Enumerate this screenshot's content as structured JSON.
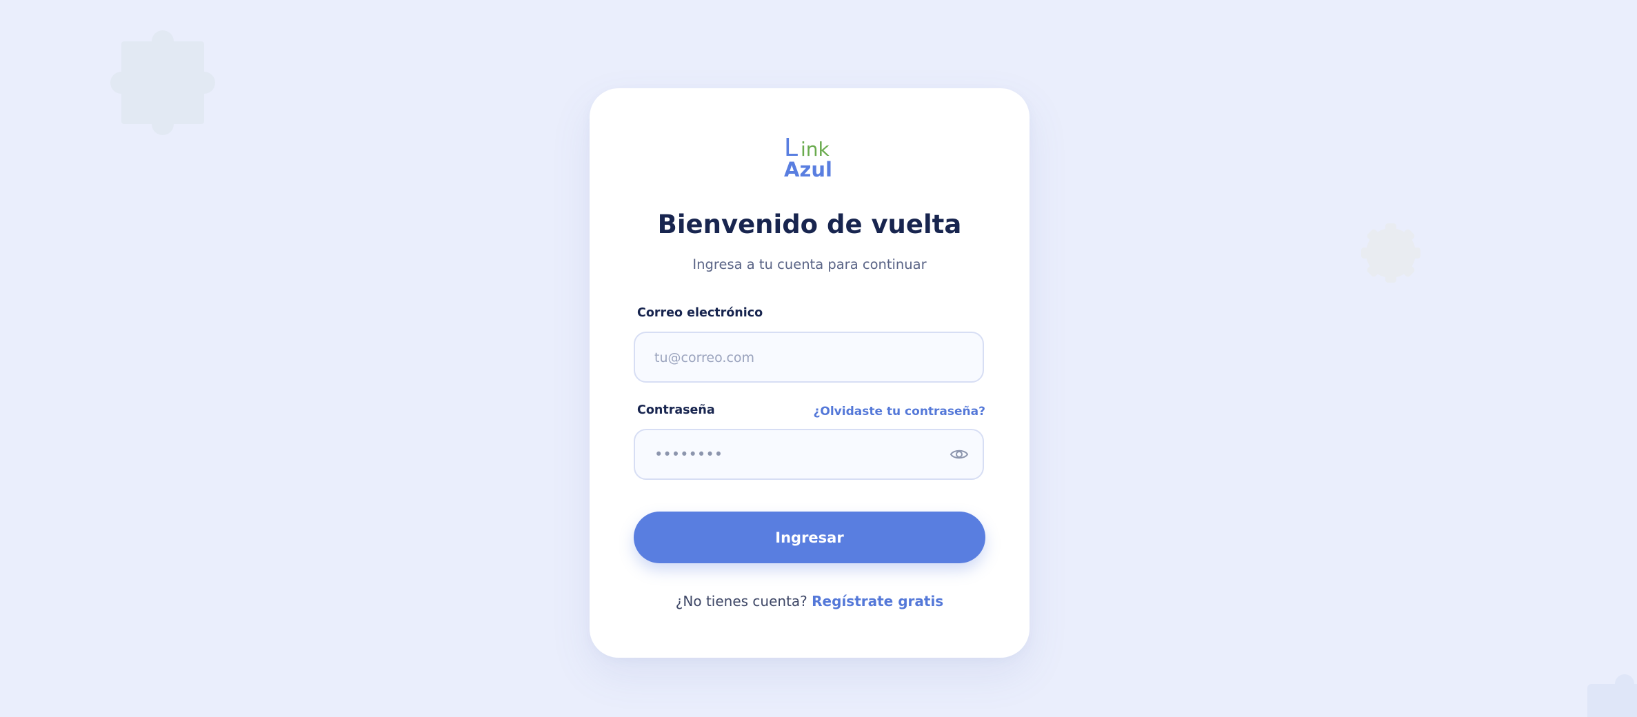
{
  "brand": {
    "logo_line1_a": "L",
    "logo_line1_b": "ink",
    "logo_line2": "Azul",
    "primary_color": "#597ee0",
    "secondary_color": "#6aab4e",
    "title_color": "#18254f"
  },
  "login": {
    "title": "Bienvenido de vuelta",
    "subtitle": "Ingresa a tu cuenta para continuar",
    "email_label": "Correo electrónico",
    "email_placeholder": "tu@correo.com",
    "email_value": "",
    "password_label": "Contraseña",
    "forgot_link": "¿Olvidaste tu contraseña?",
    "password_mask": "••••••••",
    "password_toggle_icon": "eye-icon",
    "submit_label": "Ingresar",
    "signup_prompt": "¿No tienes cuenta?",
    "signup_link": "Regístrate gratis"
  },
  "decorations": {
    "shapes": [
      "puzzle-piece-icon",
      "gear-shape",
      "corner-shape"
    ]
  }
}
